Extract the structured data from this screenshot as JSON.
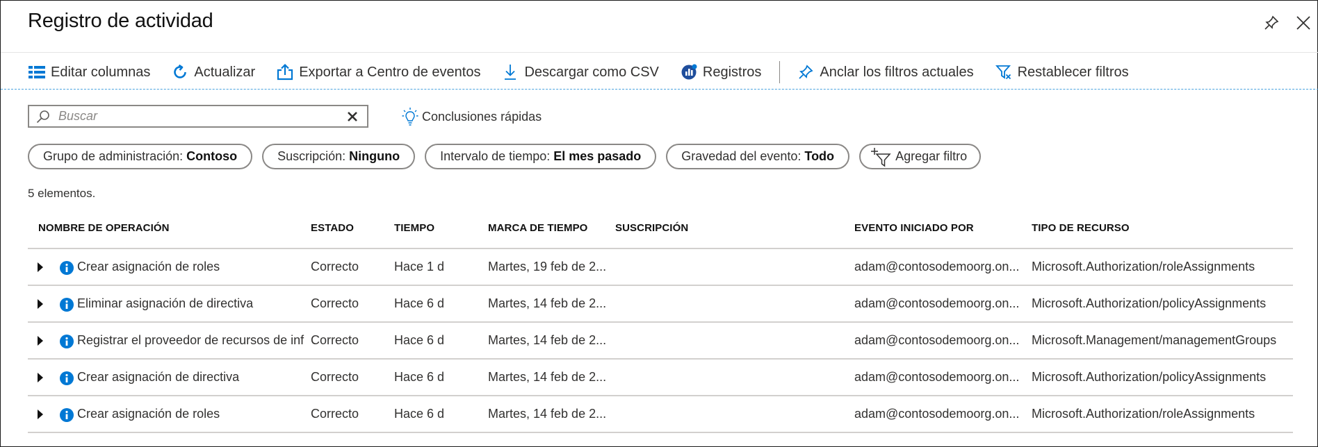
{
  "window": {
    "title": "Registro de actividad"
  },
  "toolbar": {
    "items": [
      {
        "label": "Editar columnas",
        "icon": "columns-icon"
      },
      {
        "label": "Actualizar",
        "icon": "refresh-icon"
      },
      {
        "label": "Exportar a Centro de eventos",
        "icon": "export-icon"
      },
      {
        "label": "Descargar como CSV",
        "icon": "download-icon"
      },
      {
        "label": "Registros",
        "icon": "logs-icon"
      },
      {
        "label": "Anclar los filtros actuales",
        "icon": "pin-icon"
      },
      {
        "label": "Restablecer filtros",
        "icon": "filter-reset-icon"
      }
    ]
  },
  "search": {
    "placeholder": "Buscar",
    "value": ""
  },
  "insights": {
    "label": "Conclusiones rápidas"
  },
  "filters": [
    {
      "key": "Grupo de administración:",
      "value": "Contoso"
    },
    {
      "key": "Suscripción:",
      "value": "Ninguno"
    },
    {
      "key": "Intervalo de tiempo:",
      "value": "El mes pasado"
    },
    {
      "key": "Gravedad del evento:",
      "value": "Todo"
    }
  ],
  "add_filter_label": "Agregar filtro",
  "count_text": "5 elementos.",
  "table": {
    "columns": [
      "NOMBRE DE OPERACIÓN",
      "ESTADO",
      "TIEMPO",
      "MARCA DE TIEMPO",
      "SUSCRIPCIÓN",
      "EVENTO INICIADO POR",
      "TIPO DE RECURSO"
    ],
    "rows": [
      {
        "operation": "Crear asignación de roles",
        "status": "Correcto",
        "time": "Hace 1 d",
        "timestamp": "Martes, 19 feb de 2...",
        "subscription": "",
        "initiated_by": "adam@contosodemoorg.on...",
        "resource_type": "Microsoft.Authorization/roleAssignments"
      },
      {
        "operation": "Eliminar asignación de directiva",
        "status": "Correcto",
        "time": "Hace 6 d",
        "timestamp": "Martes, 14 feb de 2...",
        "subscription": "",
        "initiated_by": "adam@contosodemoorg.on...",
        "resource_type": "Microsoft.Authorization/policyAssignments"
      },
      {
        "operation": "Registrar el proveedor de recursos de inf",
        "status": "Correcto",
        "time": "Hace 6 d",
        "timestamp": "Martes, 14 feb de 2...",
        "subscription": "",
        "initiated_by": "adam@contosodemoorg.on...",
        "resource_type": "Microsoft.Management/managementGroups"
      },
      {
        "operation": "Crear asignación de directiva",
        "status": "Correcto",
        "time": "Hace 6 d",
        "timestamp": "Martes, 14 feb de 2...",
        "subscription": "",
        "initiated_by": "adam@contosodemoorg.on...",
        "resource_type": "Microsoft.Authorization/policyAssignments"
      },
      {
        "operation": "Crear asignación de roles",
        "status": "Correcto",
        "time": "Hace 6 d",
        "timestamp": "Martes, 14 feb de 2...",
        "subscription": "",
        "initiated_by": "adam@contosodemoorg.on...",
        "resource_type": "Microsoft.Authorization/roleAssignments"
      }
    ]
  },
  "colors": {
    "accent": "#0078d4",
    "text": "#323130",
    "border": "#8a8886"
  }
}
